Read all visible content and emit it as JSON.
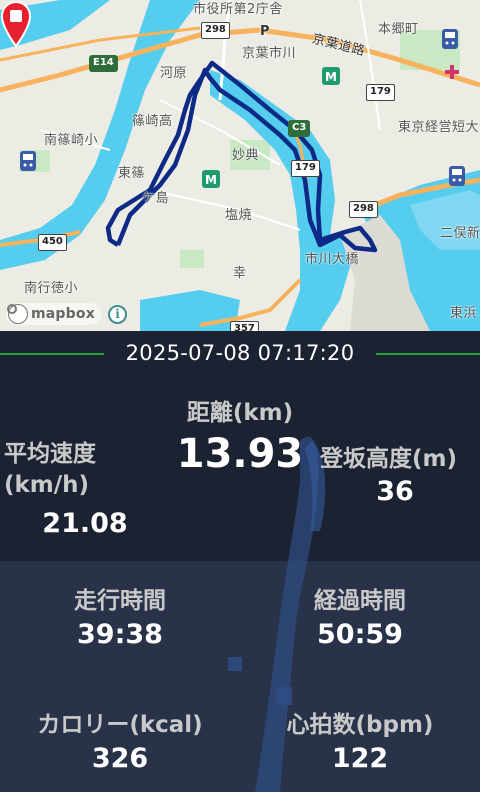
{
  "map": {
    "labels": {
      "shiyakusho": "市役所第2庁舎",
      "hongocho": "本郷町",
      "keiyo_road": "京葉道路",
      "keiyo_ichikawa": "京葉市川",
      "kawahara": "河原",
      "shinozaki_high": "篠崎高",
      "minami_shinozaki": "南篠崎小",
      "myoten": "妙典",
      "higashi_shinozaki": "東篠",
      "gakashima": "ケ島",
      "shiohama": "塩焼",
      "saiwai": "幸",
      "ichikawa_ohashi": "市川大橋",
      "tokyo_keiei": "東京経営短大",
      "nihoten": "二俣新",
      "minami_gyotoku": "南行徳小",
      "higashi_hama": "東浜",
      "iji": "P"
    },
    "route_shields": {
      "r298_top": "298",
      "r298_right": "298",
      "r179_a": "179",
      "r179_b": "179",
      "c3": "C3",
      "e14": "E14",
      "r450": "450",
      "r357": "357"
    },
    "attribution": "mapbox",
    "info_symbol": "i"
  },
  "stats": {
    "datetime": "2025-07-08 07:17:20",
    "distance_label": "距離(km)",
    "distance_value": "13.93",
    "avg_speed_label": "平均速度(km/h)",
    "avg_speed_value": "21.08",
    "climb_label": "登坂高度(m)",
    "climb_value": "36",
    "ride_time_label": "走行時間",
    "ride_time_value": "39:38",
    "elapsed_label": "経過時間",
    "elapsed_value": "50:59",
    "calories_label": "カロリー(kcal)",
    "calories_value": "326",
    "heart_label": "心拍数(bpm)",
    "heart_value": "122"
  },
  "colors": {
    "route": "#0d2a86",
    "water": "#54cdee",
    "map_bg": "#ecebe4",
    "stats_bg": "#1b2231",
    "accent_green": "#27a33a",
    "marker_red": "#e8212e"
  }
}
